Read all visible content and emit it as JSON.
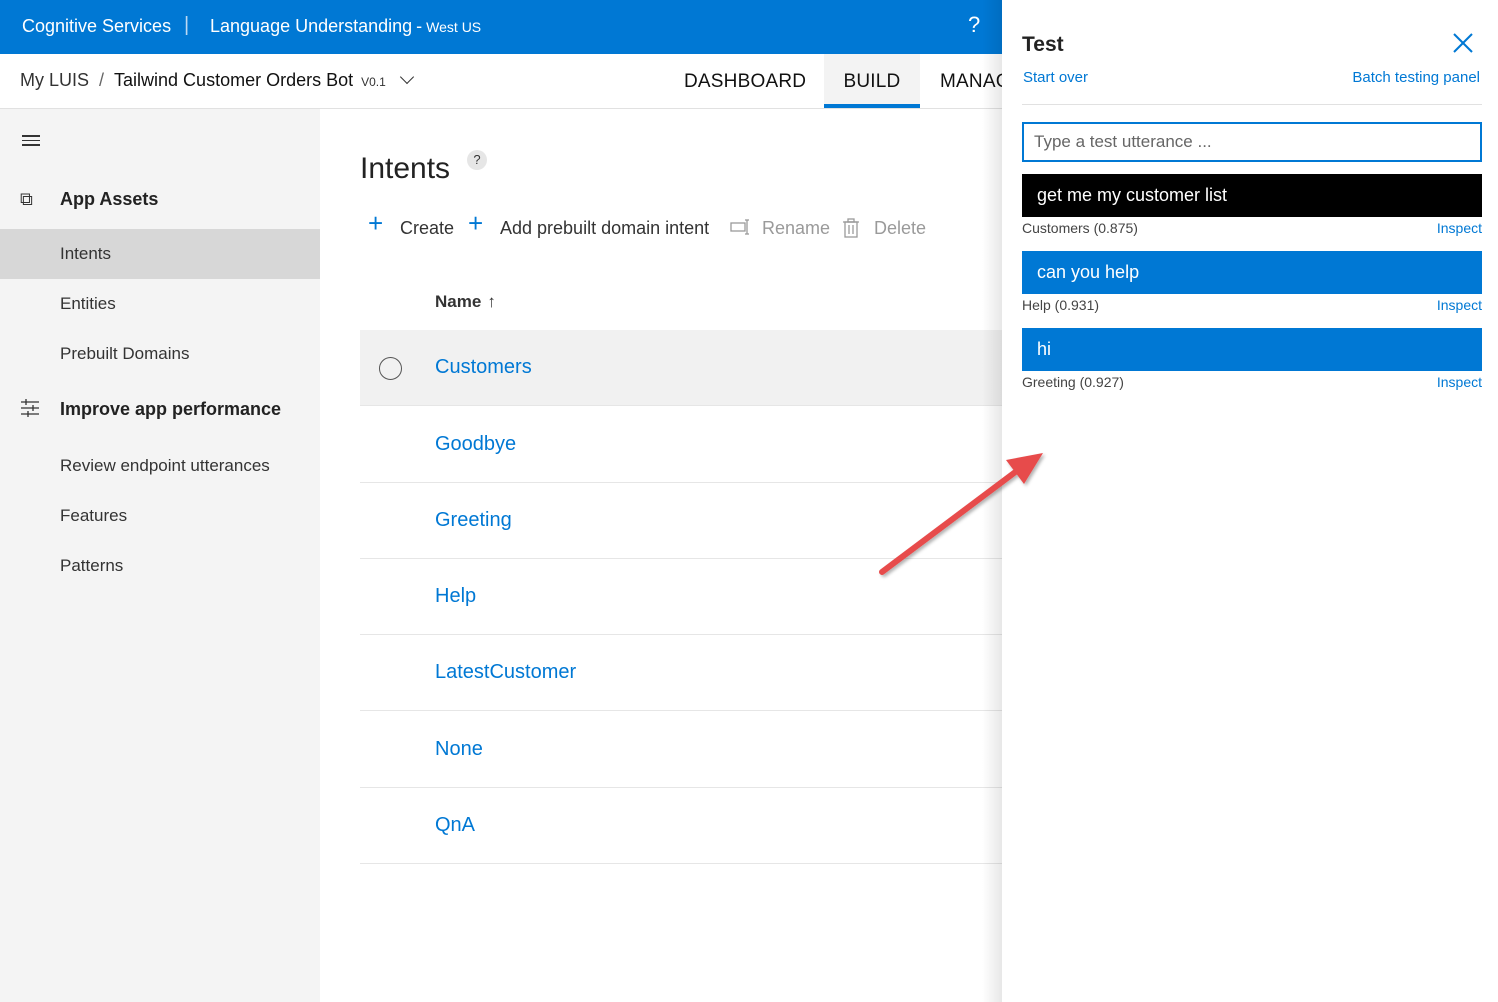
{
  "topbar": {
    "brand": "Cognitive Services",
    "separator": "|",
    "product": "Language Understanding",
    "region_dash": "-",
    "region": "West US",
    "help": "?"
  },
  "appbar": {
    "breadcrumb_root": "My LUIS",
    "breadcrumb_sep": "/",
    "app_name": "Tailwind Customer Orders Bot",
    "version": "V0.1",
    "tabs": [
      {
        "label": "DASHBOARD"
      },
      {
        "label": "BUILD",
        "active": true
      },
      {
        "label": "MANAGE"
      }
    ]
  },
  "sidebar": {
    "section_assets": "App Assets",
    "items_assets": [
      {
        "label": "Intents",
        "active": true
      },
      {
        "label": "Entities"
      },
      {
        "label": "Prebuilt Domains"
      }
    ],
    "section_improve": "Improve app performance",
    "items_improve": [
      {
        "label": "Review endpoint utterances"
      },
      {
        "label": "Features"
      },
      {
        "label": "Patterns"
      }
    ]
  },
  "main": {
    "title": "Intents",
    "help_badge": "?",
    "toolbar": {
      "create": "Create",
      "add_prebuilt": "Add prebuilt domain intent",
      "rename": "Rename",
      "delete": "Delete"
    },
    "column_name": "Name",
    "sort_arrow": "↑",
    "intents": [
      "Customers",
      "Goodbye",
      "Greeting",
      "Help",
      "LatestCustomer",
      "None",
      "QnA"
    ]
  },
  "test_panel": {
    "title": "Test",
    "start_over": "Start over",
    "batch": "Batch testing panel",
    "input_placeholder": "Type a test utterance ...",
    "utterances": [
      {
        "text": "get me my customer list",
        "result": "Customers (0.875)",
        "inspect": "Inspect"
      },
      {
        "text": "can you help",
        "result": "Help (0.931)",
        "inspect": "Inspect"
      },
      {
        "text": "hi",
        "result": "Greeting (0.927)",
        "inspect": "Inspect"
      }
    ]
  },
  "colors": {
    "accent": "#0078d4",
    "arrow": "#e74c4c"
  }
}
